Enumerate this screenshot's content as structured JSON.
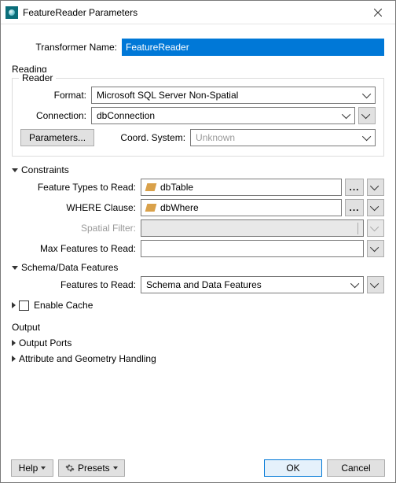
{
  "window": {
    "title": "FeatureReader Parameters"
  },
  "transformerName": {
    "label": "Transformer Name:",
    "value": "FeatureReader"
  },
  "reading": {
    "title": "Reading",
    "reader": {
      "legend": "Reader",
      "format": {
        "label": "Format:",
        "value": "Microsoft SQL Server Non-Spatial"
      },
      "connection": {
        "label": "Connection:",
        "value": "dbConnection"
      },
      "parametersBtn": "Parameters...",
      "coordSystem": {
        "label": "Coord. System:",
        "value": "Unknown"
      }
    },
    "constraints": {
      "title": "Constraints",
      "featureTypes": {
        "label": "Feature Types to Read:",
        "value": "dbTable"
      },
      "whereClause": {
        "label": "WHERE Clause:",
        "value": "dbWhere"
      },
      "spatialFilter": {
        "label": "Spatial Filter:",
        "value": ""
      },
      "maxFeatures": {
        "label": "Max Features to Read:",
        "value": ""
      }
    },
    "schemaData": {
      "title": "Schema/Data Features",
      "featuresToRead": {
        "label": "Features to Read:",
        "value": "Schema and Data Features"
      }
    },
    "enableCache": {
      "label": "Enable Cache"
    }
  },
  "output": {
    "title": "Output",
    "ports": "Output Ports",
    "attrGeom": "Attribute and Geometry Handling"
  },
  "footer": {
    "help": "Help",
    "presets": "Presets",
    "ok": "OK",
    "cancel": "Cancel"
  }
}
